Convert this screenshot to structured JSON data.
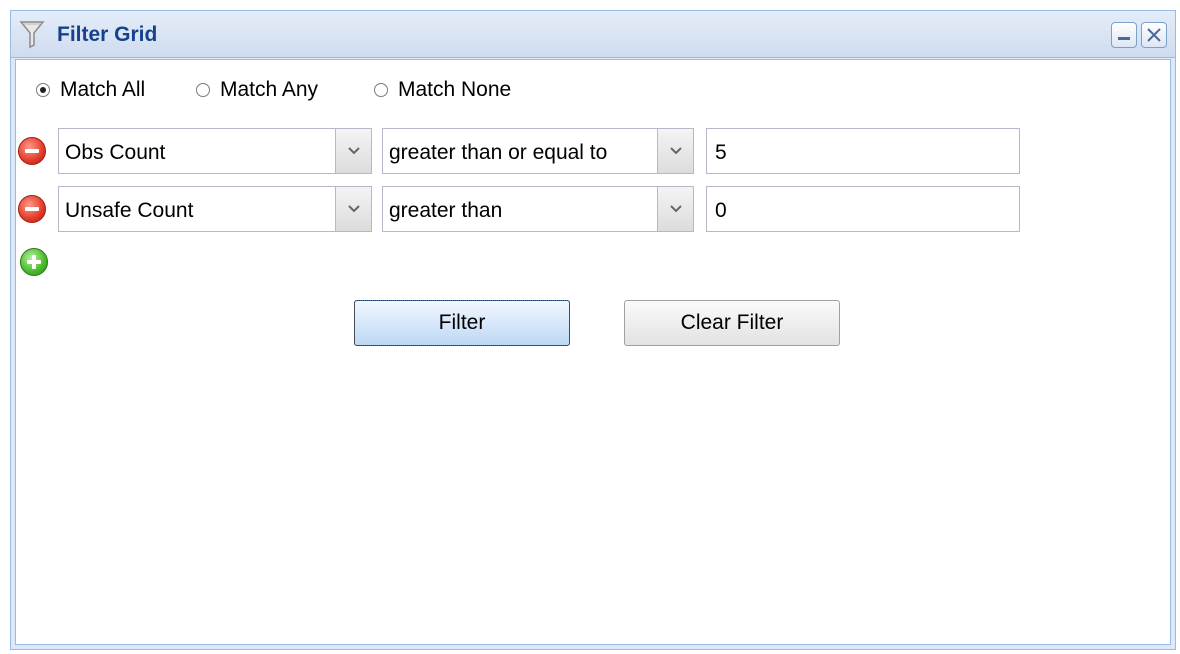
{
  "window": {
    "title": "Filter Grid",
    "title_icon": "funnel-icon",
    "tools": {
      "minimize_icon": "minimize-icon",
      "close_icon": "close-icon"
    }
  },
  "match_mode": {
    "options": [
      "Match All",
      "Match Any",
      "Match None"
    ],
    "selected": "Match All"
  },
  "conditions": [
    {
      "field": "Obs Count",
      "operator": "greater than or equal to",
      "value": "5"
    },
    {
      "field": "Unsafe Count",
      "operator": "greater than",
      "value": "0"
    }
  ],
  "actions": {
    "filter_label": "Filter",
    "clear_label": "Clear Filter"
  },
  "colors": {
    "accent": "#99bbe8",
    "title_text": "#15428b",
    "remove": "#e23a2a",
    "add": "#47b82a"
  }
}
